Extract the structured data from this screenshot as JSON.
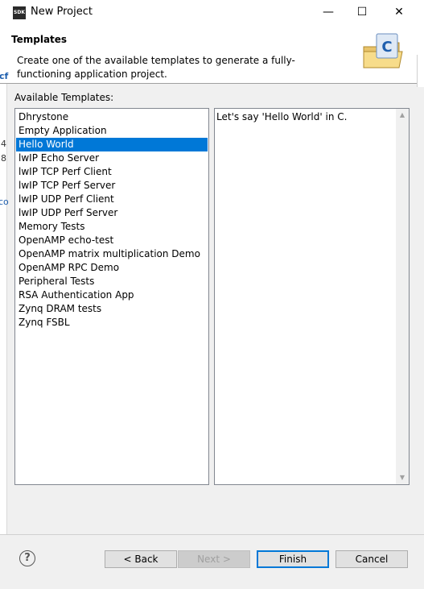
{
  "window": {
    "icon_label": "SDK",
    "title": "New Project",
    "minimize_glyph": "—",
    "maximize_glyph": "☐",
    "close_glyph": "✕"
  },
  "header": {
    "title": "Templates",
    "description": "Create one of the available templates to generate a fully-functioning application project.",
    "icon": "wizard-folder-c-icon"
  },
  "templates": {
    "label": "Available Templates:",
    "selected": "Hello World",
    "items": [
      "Dhrystone",
      "Empty Application",
      "Hello World",
      "lwIP Echo Server",
      "lwIP TCP Perf Client",
      "lwIP TCP Perf Server",
      "lwIP UDP Perf Client",
      "lwIP UDP Perf Server",
      "Memory Tests",
      "OpenAMP echo-test",
      "OpenAMP matrix multiplication Demo",
      "OpenAMP RPC Demo",
      "Peripheral Tests",
      "RSA Authentication App",
      "Zynq DRAM tests",
      "Zynq FSBL"
    ]
  },
  "description_panel": {
    "text": "Let's say 'Hello World' in C."
  },
  "background_fragments": [
    "cf",
    "4",
    "8",
    "co"
  ],
  "footer": {
    "help_glyph": "?",
    "back_label": "< Back",
    "next_label": "Next >",
    "finish_label": "Finish",
    "cancel_label": "Cancel"
  },
  "colors": {
    "selection": "#0078d7",
    "default_button_border": "#0078d7"
  }
}
